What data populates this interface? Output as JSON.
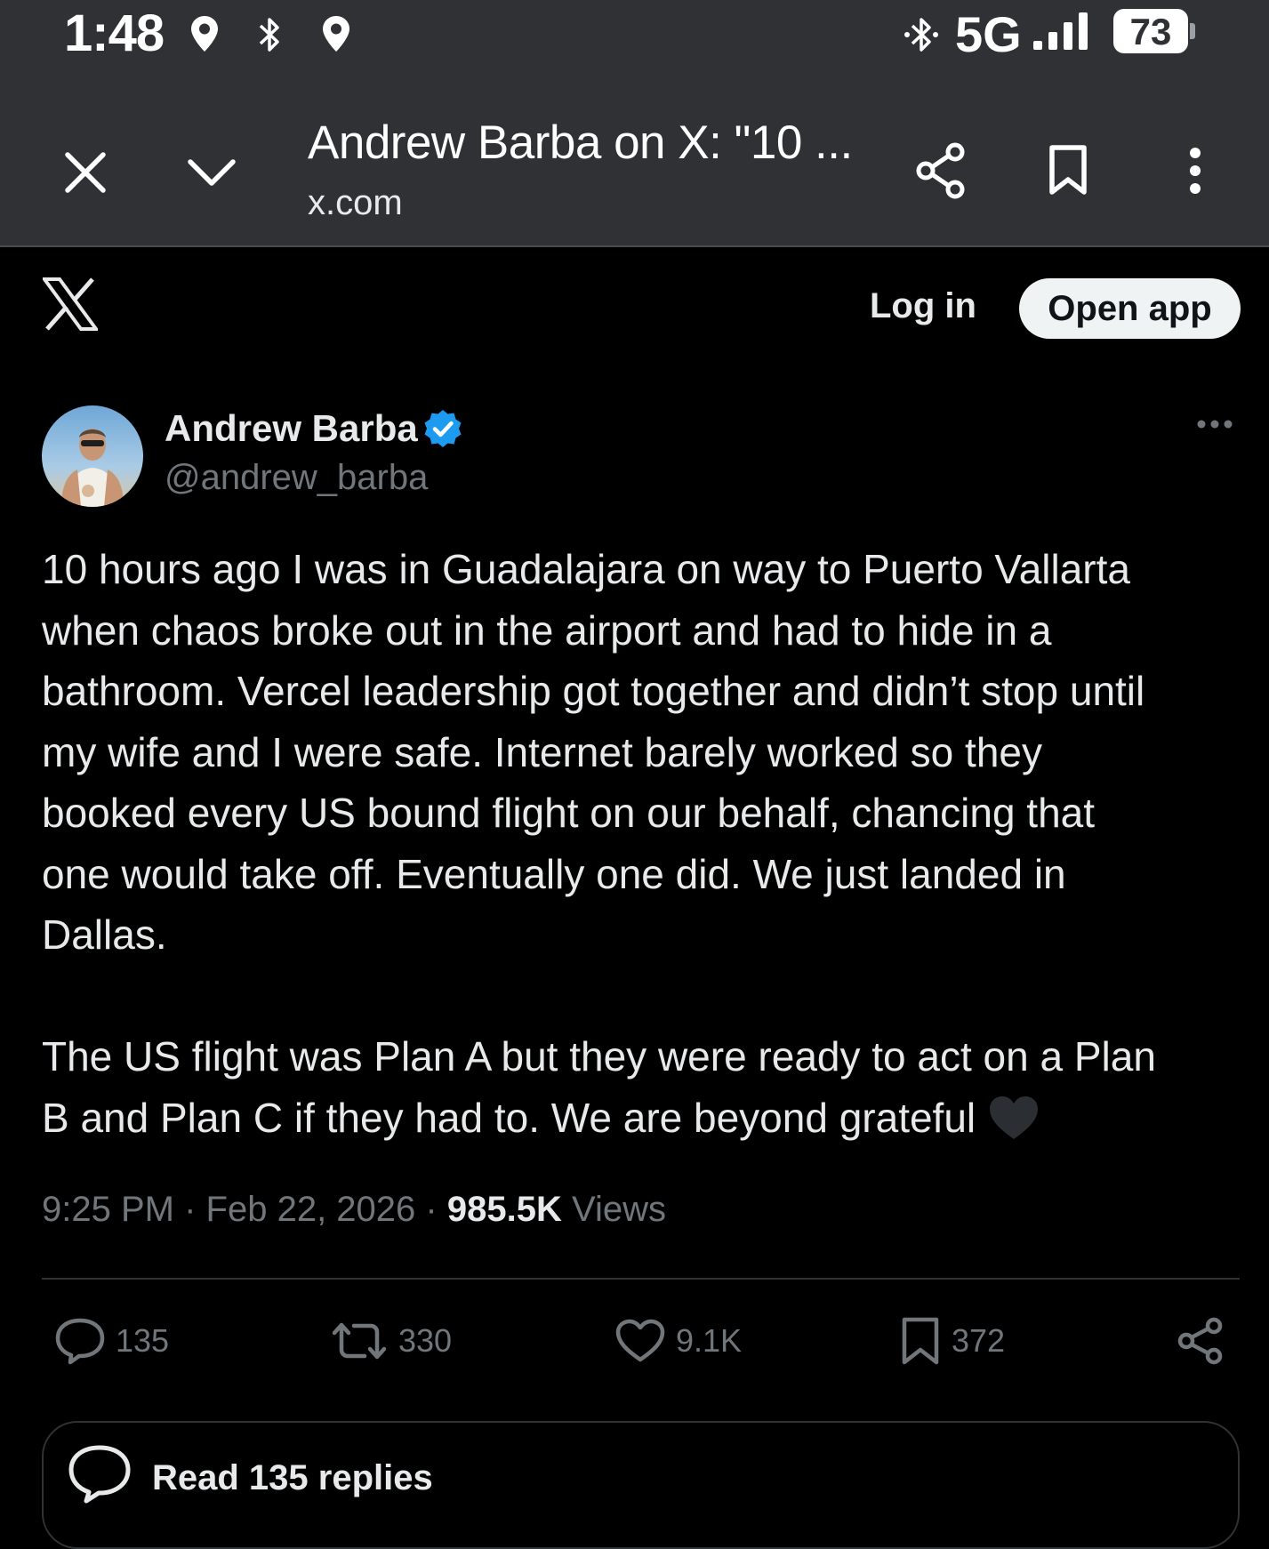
{
  "status_bar": {
    "time": "1:48",
    "network": "5G",
    "battery": "73",
    "icons": [
      "location-icon",
      "bluetooth-icon",
      "location-icon",
      "bluetooth-icon",
      "signal-icon",
      "battery-icon"
    ]
  },
  "browser": {
    "title": "Andrew Barba on X: \"10 ...",
    "url": "x.com",
    "icons": [
      "close-icon",
      "chevron-down-icon",
      "share-icon",
      "bookmark-icon",
      "more-vert-icon"
    ]
  },
  "header": {
    "logo": "x-logo-icon",
    "login_label": "Log in",
    "open_app_label": "Open app"
  },
  "tweet": {
    "author_name": "Andrew Barba",
    "handle": "@andrew_barba",
    "text": "10 hours ago I was in Guadalajara on way to Puerto Vallarta\nwhen chaos broke out in the airport and had to hide in a\nbathroom. Vercel leadership got together and didn’t stop until\nmy wife and I were safe. Internet barely worked so they\nbooked every US bound flight on our behalf, chancing that\none would take off. Eventually one did. We just landed in\nDallas.\n\nThe US flight was Plan A but they were ready to act on a Plan\nB and Plan C if they had to. We are beyond grateful",
    "emoji": "black-heart-icon",
    "time": "9:25 PM",
    "separator": "·",
    "date": "Feb 22, 2026",
    "views_count": "985.5K",
    "views_label": "Views"
  },
  "actions": {
    "replies": "135",
    "reposts": "330",
    "likes": "9.1K",
    "bookmarks": "372"
  },
  "read_replies_label": "Read 135 replies",
  "colors": {
    "background": "#000000",
    "chrome": "#303134",
    "text": "#e7e9ea",
    "muted": "#71767b",
    "verified": "#1d9bf0",
    "divider": "#2f3336"
  }
}
